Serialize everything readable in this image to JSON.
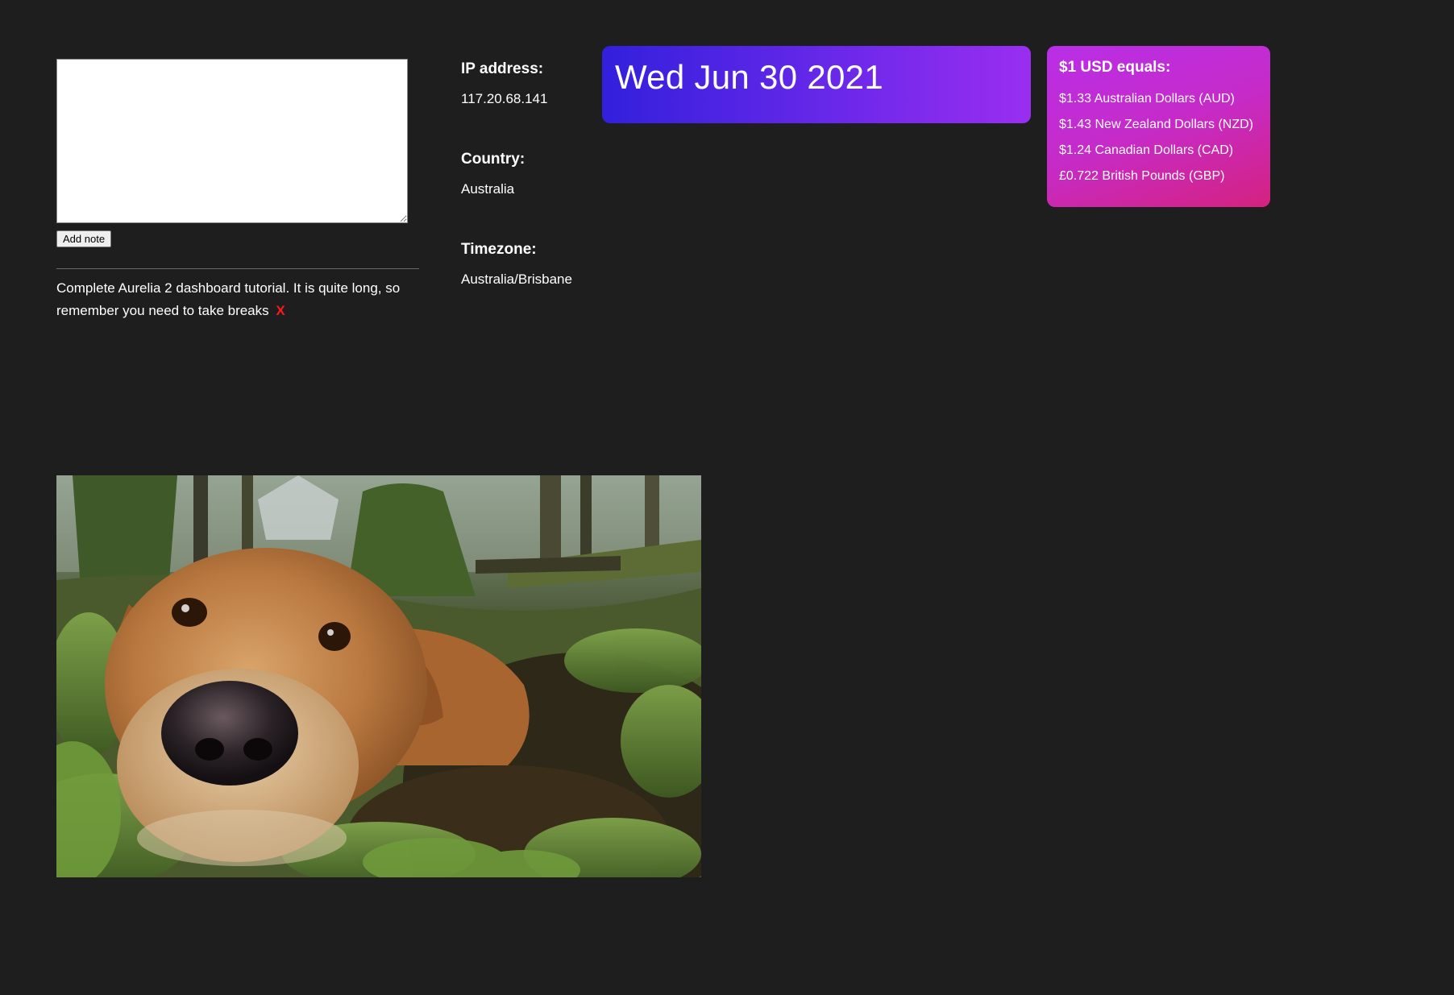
{
  "notes": {
    "textarea_value": "",
    "add_button_label": "Add note",
    "items": [
      {
        "text": "Complete Aurelia 2 dashboard tutorial. It is quite long, so remember you need to take breaks",
        "remove_label": "X"
      }
    ]
  },
  "ipinfo": {
    "ip_label": "IP address:",
    "ip_value": "117.20.68.141",
    "country_label": "Country:",
    "country_value": "Australia",
    "timezone_label": "Timezone:",
    "timezone_value": "Australia/Brisbane"
  },
  "date_card": {
    "date": "Wed Jun 30 2021",
    "gradient_start": "#3220dc",
    "gradient_end": "#9a2ef0"
  },
  "currency": {
    "title": "$1 USD equals:",
    "rates": [
      "$1.33 Australian Dollars (AUD)",
      "$1.43 New Zealand Dollars (NZD)",
      "$1.24 Canadian Dollars (CAD)",
      "£0.722 British Pounds (GBP)"
    ],
    "gradient_start": "#b92ee8",
    "gradient_end": "#d5227f"
  },
  "photo": {
    "alt": "dog-photo"
  },
  "colors": {
    "background": "#1e1e1e",
    "remove_x": "#ff1a1a"
  }
}
